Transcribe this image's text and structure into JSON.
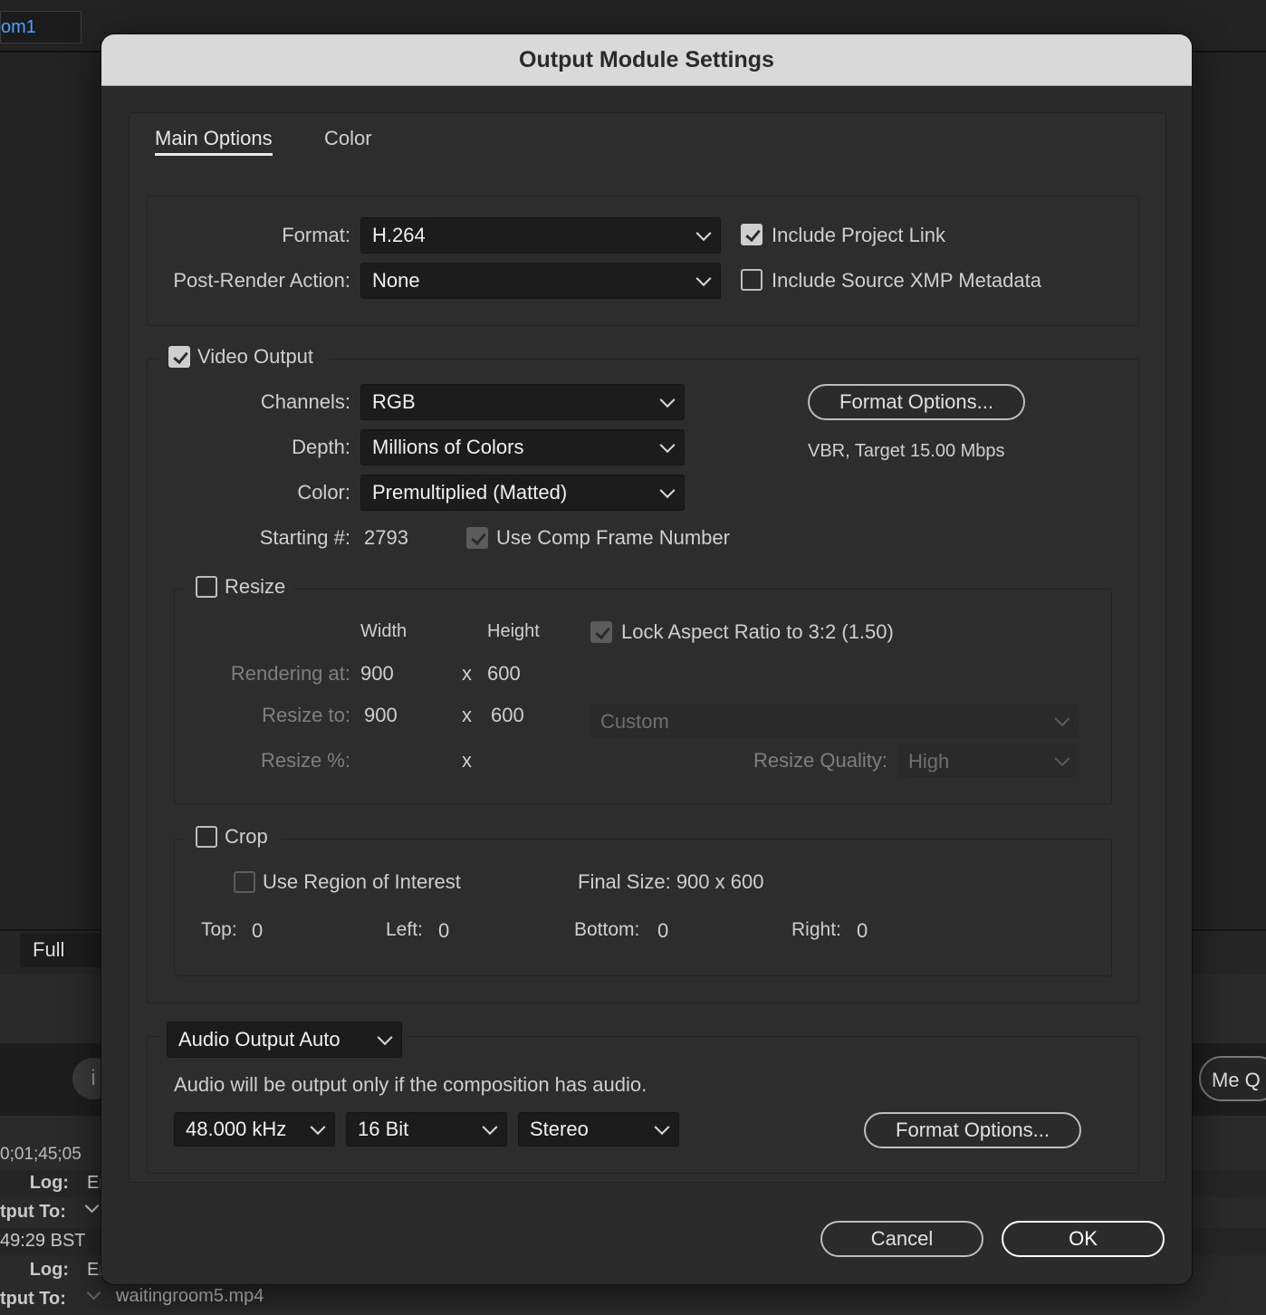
{
  "background": {
    "comp_tab": "om1",
    "resolution_value": "Full",
    "timecode": "0;01;45;05",
    "log_label_1": "Log:",
    "log_value_1": "Er",
    "output_to_label_1": "tput To:",
    "time_bst": "49:29 BST",
    "log_label_2": "Log:",
    "log_value_2": "Er",
    "output_to_label_2": "tput To:",
    "output_file": "waitingroom5.mp4",
    "me_button": "Me Q"
  },
  "dialog": {
    "title": "Output Module Settings",
    "tabs": [
      "Main Options",
      "Color"
    ],
    "format": {
      "label": "Format:",
      "value": "H.264",
      "post_render_label": "Post-Render Action:",
      "post_render_value": "None",
      "include_project_link": "Include Project Link",
      "include_xmp": "Include Source XMP Metadata"
    },
    "video": {
      "title": "Video Output",
      "channels_label": "Channels:",
      "channels_value": "RGB",
      "depth_label": "Depth:",
      "depth_value": "Millions of Colors",
      "color_label": "Color:",
      "color_value": "Premultiplied (Matted)",
      "starting_label": "Starting #:",
      "starting_value": "2793",
      "use_comp_frame": "Use Comp Frame Number",
      "format_options_button": "Format Options...",
      "bitrate_note": "VBR, Target 15.00 Mbps"
    },
    "resize": {
      "title": "Resize",
      "width_header": "Width",
      "height_header": "Height",
      "lock_aspect": "Lock Aspect Ratio to 3:2 (1.50)",
      "rendering_label": "Rendering at:",
      "rendering_w": "900",
      "rendering_h": "600",
      "resize_to_label": "Resize to:",
      "resize_to_w": "900",
      "resize_to_h": "600",
      "preset_value": "Custom",
      "resize_pct_label": "Resize %:",
      "x_symbol": "x",
      "quality_label": "Resize Quality:",
      "quality_value": "High"
    },
    "crop": {
      "title": "Crop",
      "use_roi": "Use Region of Interest",
      "final_size": "Final Size: 900 x 600",
      "top_label": "Top:",
      "top_value": "0",
      "left_label": "Left:",
      "left_value": "0",
      "bottom_label": "Bottom:",
      "bottom_value": "0",
      "right_label": "Right:",
      "right_value": "0"
    },
    "audio": {
      "mode_value": "Audio Output Auto",
      "note": "Audio will be output only if the composition has audio.",
      "sample_rate": "48.000 kHz",
      "bit_depth": "16 Bit",
      "channels": "Stereo",
      "format_options_button": "Format Options..."
    },
    "buttons": {
      "cancel": "Cancel",
      "ok": "OK"
    }
  }
}
